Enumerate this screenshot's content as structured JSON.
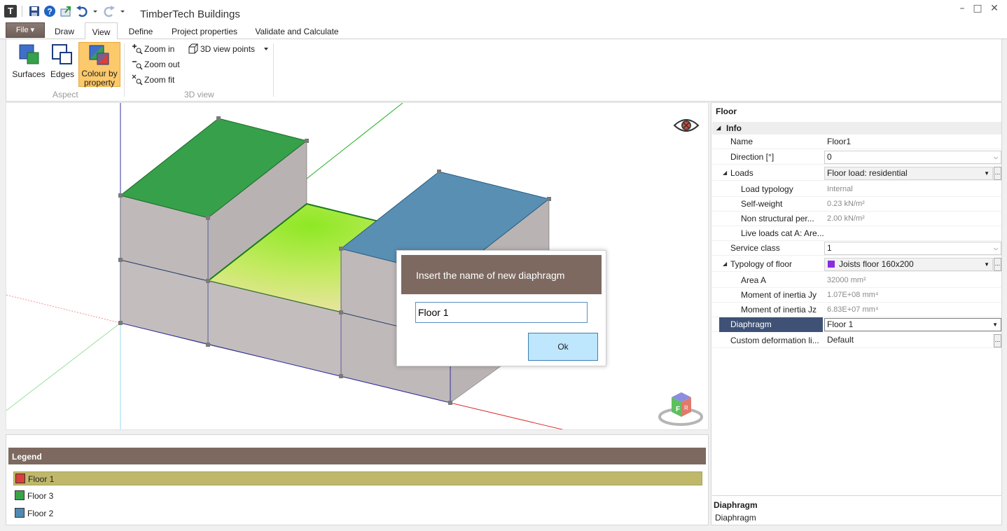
{
  "window": {
    "title": "TimberTech Buildings"
  },
  "ribbon": {
    "file_label": "File ▾",
    "tabs": [
      {
        "label": "Draw"
      },
      {
        "label": "View"
      },
      {
        "label": "Define"
      },
      {
        "label": "Project properties"
      },
      {
        "label": "Validate and Calculate"
      }
    ],
    "active_tab": "View",
    "aspect": {
      "surfaces": "Surfaces",
      "edges": "Edges",
      "colour_line1": "Colour by",
      "colour_line2": "property",
      "group": "Aspect"
    },
    "view3d": {
      "zoom_in": "Zoom in",
      "zoom_out": "Zoom out",
      "zoom_fit": "Zoom fit",
      "view_points": "3D view points",
      "group": "3D view"
    }
  },
  "dialog": {
    "title": "Insert the name of new diaphragm",
    "value": "Floor 1",
    "ok": "Ok"
  },
  "legend": {
    "title": "Legend",
    "items": [
      {
        "label": "Floor 1",
        "color": "#d9413a",
        "selected": true
      },
      {
        "label": "Floor 3",
        "color": "#3aa346"
      },
      {
        "label": "Floor 2",
        "color": "#4f8ab4"
      }
    ]
  },
  "properties": {
    "title": "Floor",
    "category": "Info",
    "name": {
      "label": "Name",
      "value": "Floor1"
    },
    "direction": {
      "label": "Direction [°]",
      "value": "0"
    },
    "loads": {
      "label": "Loads",
      "value": "Floor load: residential"
    },
    "load_typology": {
      "label": "Load typology",
      "value": "Internal"
    },
    "self_weight": {
      "label": "Self-weight",
      "value": "0.23 kN/m²"
    },
    "non_structural": {
      "label": "Non structural per...",
      "value": "2.00 kN/m²"
    },
    "live_loads": {
      "label": "Live loads cat A: Are..."
    },
    "service_class": {
      "label": "Service class",
      "value": "1"
    },
    "typology": {
      "label": "Typology of floor",
      "value": "Joists floor 160x200",
      "color": "#8a2be2"
    },
    "area": {
      "label": "Area A",
      "value": "32000 mm²"
    },
    "inertia_y": {
      "label": "Moment of inertia Jy",
      "value": "1.07E+08 mm⁴"
    },
    "inertia_z": {
      "label": "Moment of inertia Jz",
      "value": "6.83E+07 mm⁴"
    },
    "diaphragm": {
      "label": "Diaphragm",
      "value": "Floor 1"
    },
    "custom_deformation": {
      "label": "Custom deformation li...",
      "value": "Default"
    },
    "description": {
      "title": "Diaphragm",
      "text": "Diaphragm"
    }
  },
  "colors": {
    "accent_brown": "#7d6960",
    "selection_blue": "#3f5276",
    "green_roof": "#3aa346",
    "blue_roof": "#5a8fb4",
    "wall": "#bcb5b5"
  }
}
